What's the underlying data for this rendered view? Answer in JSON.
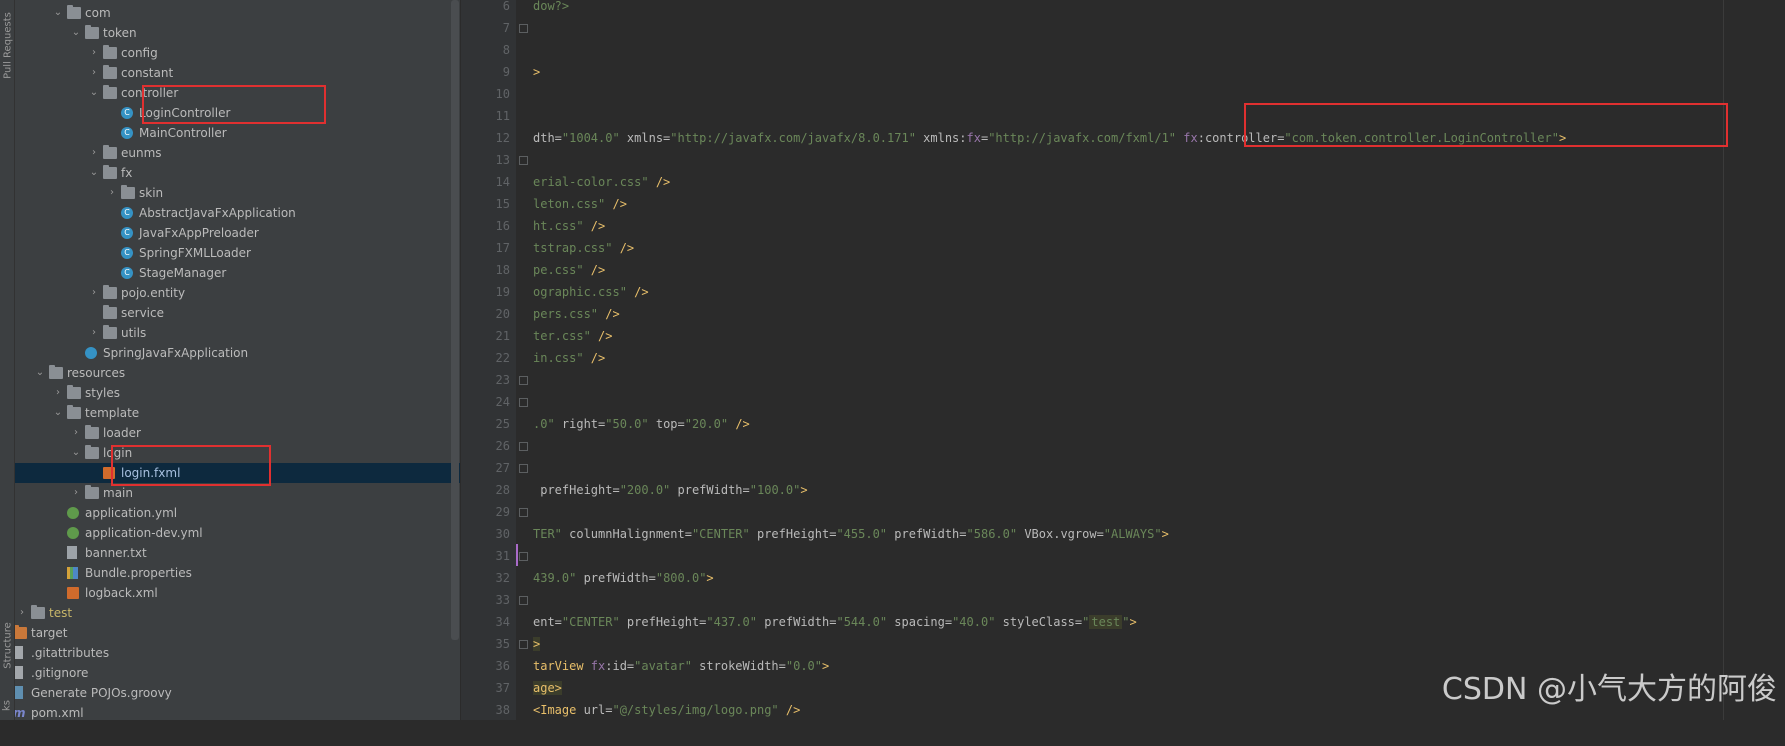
{
  "left_strip": {
    "top_label": "Pull Requests",
    "bottom_label": "Structure",
    "corner_label": "ks"
  },
  "tree": [
    {
      "label": "com",
      "type": "folder",
      "level": 5,
      "expanded": true
    },
    {
      "label": "token",
      "type": "folder",
      "level": 6,
      "expanded": true
    },
    {
      "label": "config",
      "type": "folder",
      "level": 7,
      "expanded": false
    },
    {
      "label": "constant",
      "type": "folder",
      "level": 7,
      "expanded": false
    },
    {
      "label": "controller",
      "type": "folder",
      "level": 7,
      "expanded": true
    },
    {
      "label": "LoginController",
      "type": "class",
      "level": 8
    },
    {
      "label": "MainController",
      "type": "class",
      "level": 8
    },
    {
      "label": "eunms",
      "type": "folder",
      "level": 7,
      "expanded": false
    },
    {
      "label": "fx",
      "type": "folder",
      "level": 7,
      "expanded": true
    },
    {
      "label": "skin",
      "type": "folder",
      "level": 8,
      "expanded": false
    },
    {
      "label": "AbstractJavaFxApplication",
      "type": "class",
      "level": 8
    },
    {
      "label": "JavaFxAppPreloader",
      "type": "class",
      "level": 8
    },
    {
      "label": "SpringFXMLLoader",
      "type": "class",
      "level": 8
    },
    {
      "label": "StageManager",
      "type": "class",
      "level": 8
    },
    {
      "label": "pojo.entity",
      "type": "folder",
      "level": 7,
      "expanded": false
    },
    {
      "label": "service",
      "type": "folder",
      "level": 7
    },
    {
      "label": "utils",
      "type": "folder",
      "level": 7,
      "expanded": false
    },
    {
      "label": "SpringJavaFxApplication",
      "type": "module",
      "level": 6
    },
    {
      "label": "resources",
      "type": "folder",
      "level": 4,
      "expanded": true
    },
    {
      "label": "styles",
      "type": "folder",
      "level": 5,
      "expanded": false
    },
    {
      "label": "template",
      "type": "folder",
      "level": 5,
      "expanded": true
    },
    {
      "label": "loader",
      "type": "folder",
      "level": 6,
      "expanded": false
    },
    {
      "label": "login",
      "type": "folder",
      "level": 6,
      "expanded": true
    },
    {
      "label": "login.fxml",
      "type": "xml",
      "level": 7,
      "selected": true,
      "color": "blue"
    },
    {
      "label": "main",
      "type": "folder",
      "level": 6,
      "expanded": false
    },
    {
      "label": "application.yml",
      "type": "yml",
      "level": 5
    },
    {
      "label": "application-dev.yml",
      "type": "yml",
      "level": 5
    },
    {
      "label": "banner.txt",
      "type": "txt",
      "level": 5
    },
    {
      "label": "Bundle.properties",
      "type": "props",
      "level": 5
    },
    {
      "label": "logback.xml",
      "type": "xml",
      "level": 5
    },
    {
      "label": "test",
      "type": "folder",
      "level": 3,
      "expanded": false,
      "color": "orange"
    },
    {
      "label": "target",
      "type": "folder-orange",
      "level": 2,
      "expanded": false
    },
    {
      "label": ".gitattributes",
      "type": "git",
      "level": 2
    },
    {
      "label": ".gitignore",
      "type": "git",
      "level": 2
    },
    {
      "label": "Generate POJOs.groovy",
      "type": "groovy",
      "level": 2
    },
    {
      "label": "pom.xml",
      "type": "maven",
      "level": 2
    }
  ],
  "editor": {
    "lines": [
      {
        "n": "6",
        "parts": [
          [
            "s",
            "dow?>"
          ]
        ]
      },
      {
        "n": "7",
        "parts": []
      },
      {
        "n": "8",
        "parts": []
      },
      {
        "n": "9",
        "parts": [
          [
            "t",
            ">"
          ]
        ]
      },
      {
        "n": "10",
        "parts": []
      },
      {
        "n": "11",
        "parts": []
      },
      {
        "n": "12",
        "parts": [
          [
            "a",
            "dth="
          ],
          [
            "s",
            "\"1004.0\""
          ],
          [
            "a",
            " xmlns="
          ],
          [
            "s",
            "\"http://javafx.com/javafx/8.0.171\""
          ],
          [
            "a",
            " xmlns:"
          ],
          [
            "p",
            "fx"
          ],
          [
            "a",
            "="
          ],
          [
            "s",
            "\"http://javafx.com/fxml/1\""
          ],
          [
            "a",
            " "
          ],
          [
            "p",
            "fx"
          ],
          [
            "a",
            ":controller="
          ],
          [
            "s",
            "\"com.token.controller.LoginController\""
          ],
          [
            "t",
            ">"
          ]
        ]
      },
      {
        "n": "13",
        "parts": []
      },
      {
        "n": "14",
        "parts": [
          [
            "s",
            "erial-color.css\""
          ],
          [
            "t",
            " />"
          ]
        ]
      },
      {
        "n": "15",
        "parts": [
          [
            "s",
            "leton.css\""
          ],
          [
            "t",
            " />"
          ]
        ]
      },
      {
        "n": "16",
        "parts": [
          [
            "s",
            "ht.css\""
          ],
          [
            "t",
            " />"
          ]
        ]
      },
      {
        "n": "17",
        "parts": [
          [
            "s",
            "tstrap.css\""
          ],
          [
            "t",
            " />"
          ]
        ]
      },
      {
        "n": "18",
        "parts": [
          [
            "s",
            "pe.css\""
          ],
          [
            "t",
            " />"
          ]
        ]
      },
      {
        "n": "19",
        "parts": [
          [
            "s",
            "ographic.css\""
          ],
          [
            "t",
            " />"
          ]
        ]
      },
      {
        "n": "20",
        "parts": [
          [
            "s",
            "pers.css\""
          ],
          [
            "t",
            " />"
          ]
        ]
      },
      {
        "n": "21",
        "parts": [
          [
            "s",
            "ter.css\""
          ],
          [
            "t",
            " />"
          ]
        ]
      },
      {
        "n": "22",
        "parts": [
          [
            "s",
            "in.css\""
          ],
          [
            "t",
            " />"
          ]
        ]
      },
      {
        "n": "23",
        "parts": []
      },
      {
        "n": "24",
        "parts": []
      },
      {
        "n": "25",
        "parts": [
          [
            "s",
            ".0\""
          ],
          [
            "a",
            " right="
          ],
          [
            "s",
            "\"50.0\""
          ],
          [
            "a",
            " top="
          ],
          [
            "s",
            "\"20.0\""
          ],
          [
            "t",
            " />"
          ]
        ]
      },
      {
        "n": "26",
        "parts": []
      },
      {
        "n": "27",
        "parts": []
      },
      {
        "n": "28",
        "parts": [
          [
            "a",
            " prefHeight="
          ],
          [
            "s",
            "\"200.0\""
          ],
          [
            "a",
            " prefWidth="
          ],
          [
            "s",
            "\"100.0\""
          ],
          [
            "t",
            ">"
          ]
        ]
      },
      {
        "n": "29",
        "parts": []
      },
      {
        "n": "30",
        "parts": [
          [
            "s",
            "TER\""
          ],
          [
            "a",
            " columnHalignment="
          ],
          [
            "s",
            "\"CENTER\""
          ],
          [
            "a",
            " prefHeight="
          ],
          [
            "s",
            "\"455.0\""
          ],
          [
            "a",
            " prefWidth="
          ],
          [
            "s",
            "\"586.0\""
          ],
          [
            "a",
            " VBox.vgrow="
          ],
          [
            "s",
            "\"ALWAYS\""
          ],
          [
            "t",
            ">"
          ]
        ]
      },
      {
        "n": "31",
        "parts": []
      },
      {
        "n": "32",
        "parts": [
          [
            "s",
            "439.0\""
          ],
          [
            "a",
            " prefWidth="
          ],
          [
            "s",
            "\"800.0\""
          ],
          [
            "t",
            ">"
          ]
        ]
      },
      {
        "n": "33",
        "parts": []
      },
      {
        "n": "34",
        "parts": [
          [
            "a",
            "ent="
          ],
          [
            "s",
            "\"CENTER\""
          ],
          [
            "a",
            " prefHeight="
          ],
          [
            "s",
            "\"437.0\""
          ],
          [
            "a",
            " prefWidth="
          ],
          [
            "s",
            "\"544.0\""
          ],
          [
            "a",
            " spacing="
          ],
          [
            "s",
            "\"40.0\""
          ],
          [
            "a",
            " styleClass="
          ],
          [
            "s",
            "\""
          ],
          [
            "m",
            "test"
          ],
          [
            "s",
            "\""
          ],
          [
            "t",
            ">"
          ]
        ]
      },
      {
        "n": "35",
        "parts": [
          [
            "b",
            ">"
          ]
        ]
      },
      {
        "n": "36",
        "parts": [
          [
            "t",
            "tarView "
          ],
          [
            "p",
            "fx"
          ],
          [
            "a",
            ":id="
          ],
          [
            "s",
            "\"avatar\""
          ],
          [
            "a",
            " strokeWidth="
          ],
          [
            "s",
            "\"0.0\""
          ],
          [
            "t",
            ">"
          ]
        ]
      },
      {
        "n": "37",
        "parts": [
          [
            "b",
            "age>"
          ]
        ]
      },
      {
        "n": "38",
        "parts": [
          [
            "t",
            "<Image "
          ],
          [
            "a",
            "url="
          ],
          [
            "s",
            "\"@/styles/img/logo.png\""
          ],
          [
            "t",
            " />"
          ]
        ]
      }
    ]
  },
  "watermark": "CSDN @小气大方的阿俊"
}
